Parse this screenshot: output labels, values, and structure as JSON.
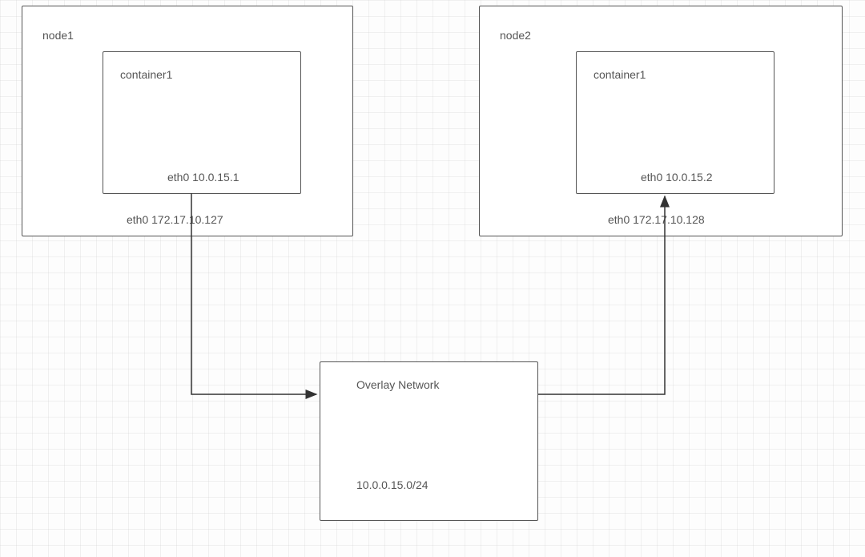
{
  "nodes": {
    "node1": {
      "title": "node1",
      "container": {
        "title": "container1",
        "interface": "eth0 10.0.15.1"
      },
      "interface": "eth0 172.17.10.127"
    },
    "node2": {
      "title": "node2",
      "container": {
        "title": "container1",
        "interface": "eth0 10.0.15.2"
      },
      "interface": "eth0 172.17.10.128"
    }
  },
  "overlay": {
    "title": "Overlay Network",
    "subnet": "10.0.0.15.0/24"
  }
}
